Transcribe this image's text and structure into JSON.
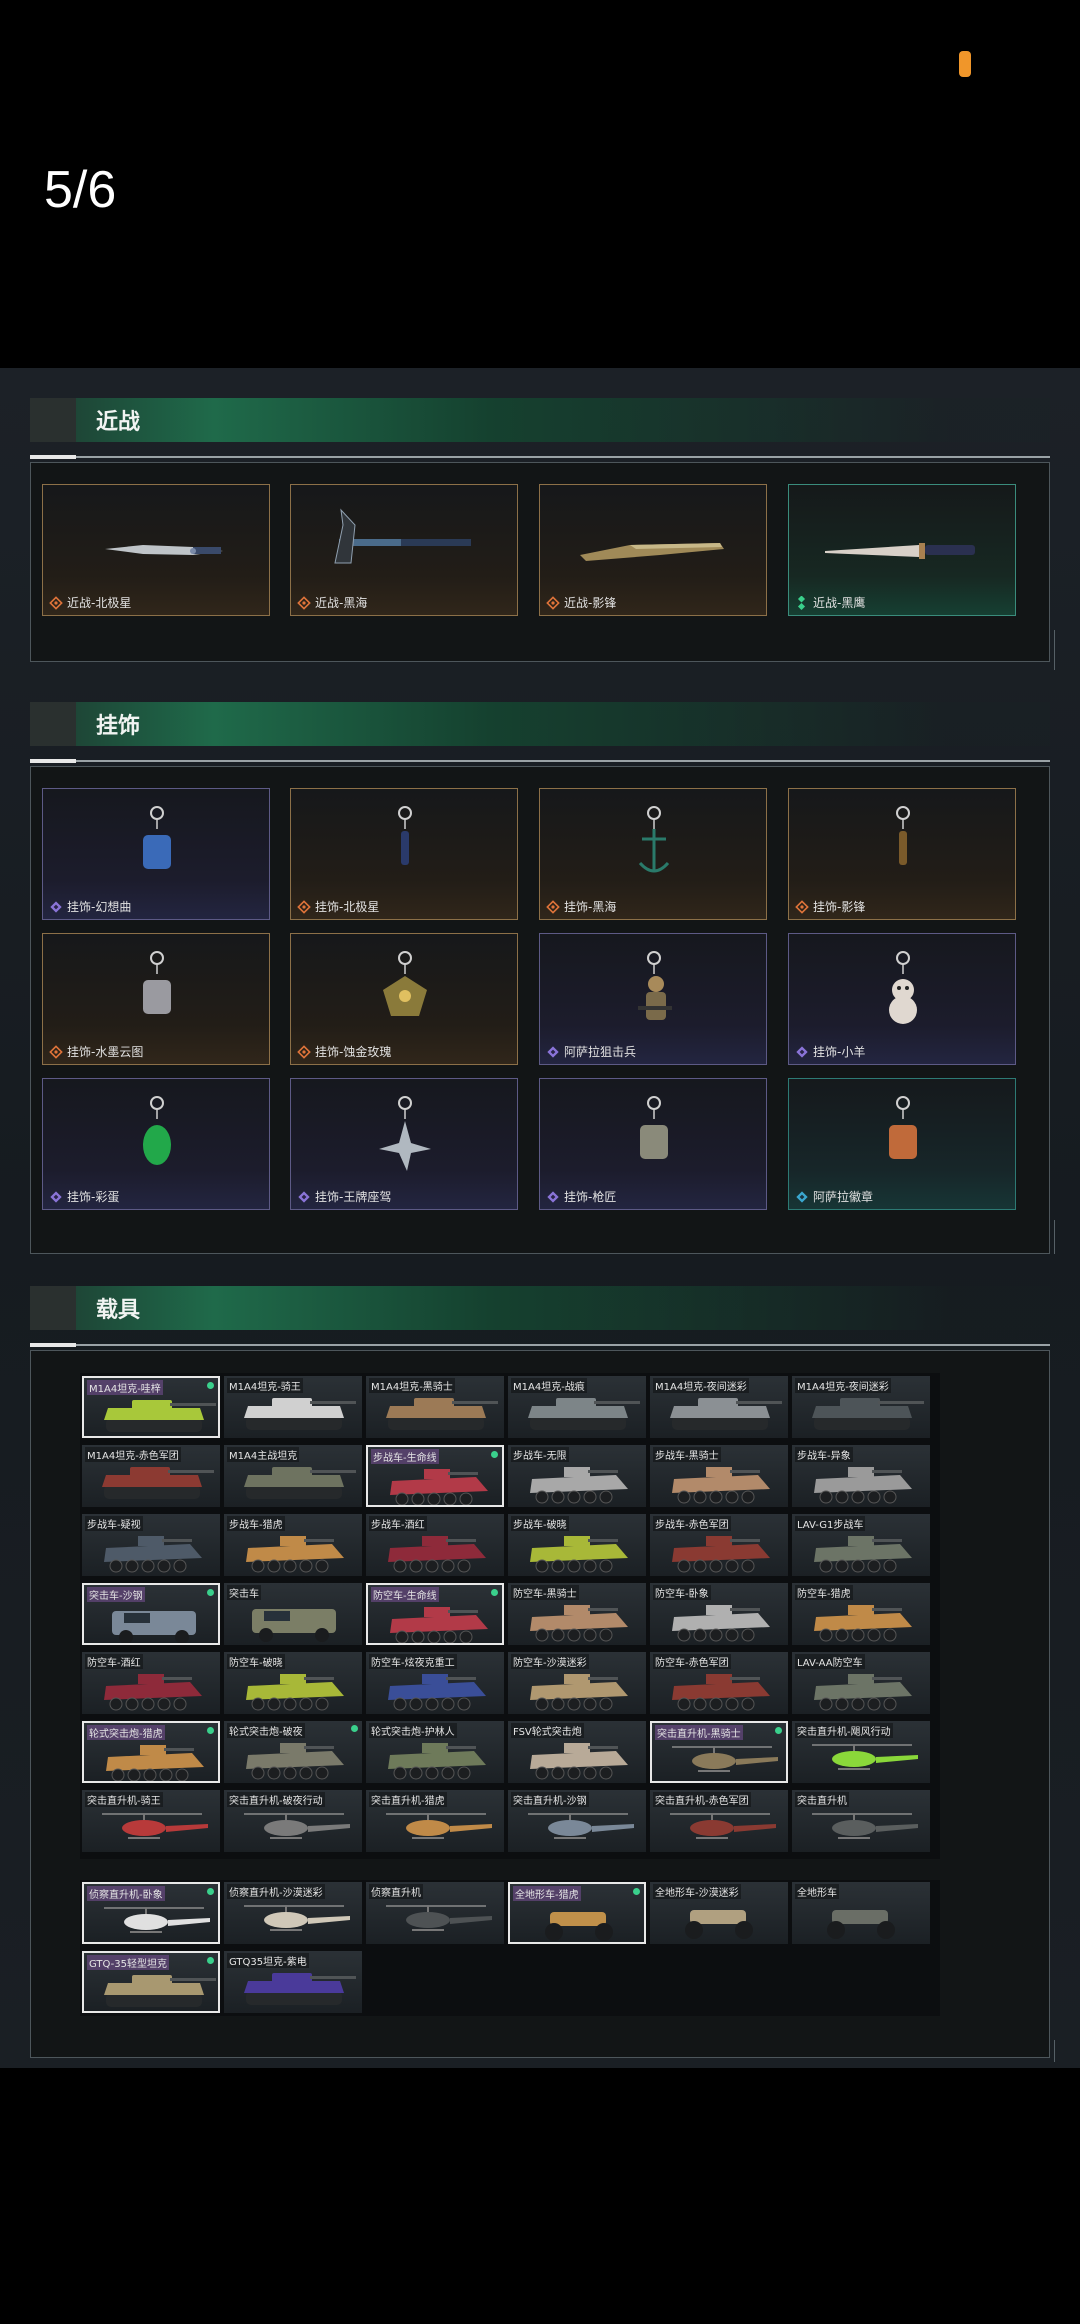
{
  "page_counter": "5/6",
  "sections": {
    "melee": {
      "title": "近战",
      "items": [
        {
          "label": "近战-北极星",
          "rarity": "gold",
          "icon": "orange-diamond-icon"
        },
        {
          "label": "近战-黑海",
          "rarity": "gold",
          "icon": "orange-diamond-icon"
        },
        {
          "label": "近战-影锋",
          "rarity": "gold",
          "icon": "orange-diamond-icon"
        },
        {
          "label": "近战-黑鹰",
          "rarity": "teal",
          "icon": "green-diamond-icon"
        }
      ]
    },
    "charms": {
      "title": "挂饰",
      "items": [
        {
          "label": "挂饰-幻想曲",
          "rarity": "purple"
        },
        {
          "label": "挂饰-北极星",
          "rarity": "gold"
        },
        {
          "label": "挂饰-黑海",
          "rarity": "gold"
        },
        {
          "label": "挂饰-影锋",
          "rarity": "gold"
        },
        {
          "label": "挂饰-水墨云图",
          "rarity": "gold"
        },
        {
          "label": "挂饰-蚀金玫瑰",
          "rarity": "gold"
        },
        {
          "label": "阿萨拉狙击兵",
          "rarity": "purple"
        },
        {
          "label": "挂饰-小羊",
          "rarity": "purple"
        },
        {
          "label": "挂饰-彩蛋",
          "rarity": "purple"
        },
        {
          "label": "挂饰-王牌座驾",
          "rarity": "purple"
        },
        {
          "label": "挂饰-枪匠",
          "rarity": "purple"
        },
        {
          "label": "阿萨拉徽章",
          "rarity": "tealb"
        }
      ]
    },
    "vehicles": {
      "title": "载具",
      "rows": [
        [
          {
            "label": "M1A4坦克-哇梓",
            "sel": true,
            "dot": true,
            "color": "#a8c83a",
            "type": "tank"
          },
          {
            "label": "M1A4坦克-骑王",
            "color": "#d0d0d0",
            "type": "tank"
          },
          {
            "label": "M1A4坦克-黑骑士",
            "color": "#9c7a56",
            "type": "tank"
          },
          {
            "label": "M1A4坦克-战痕",
            "color": "#7d8588",
            "type": "tank"
          },
          {
            "label": "M1A4坦克-夜间迷彩",
            "color": "#8b9094",
            "type": "tank"
          },
          {
            "label": "M1A4坦克-夜间迷彩",
            "color": "#4d5458",
            "type": "tank"
          }
        ],
        [
          {
            "label": "M1A4坦克-赤色军团",
            "color": "#8c3a32",
            "type": "tank"
          },
          {
            "label": "M1A4主战坦克",
            "color": "#6e7360",
            "type": "tank"
          },
          {
            "label": "步战车-生命线",
            "sel": true,
            "dot": true,
            "color": "#b23a48",
            "type": "ifv"
          },
          {
            "label": "步战车-无限",
            "color": "#a8a8a8",
            "type": "ifv"
          },
          {
            "label": "步战车-黑骑士",
            "color": "#b28a6a",
            "type": "ifv"
          },
          {
            "label": "步战车-异象",
            "color": "#9a9a9a",
            "type": "ifv"
          }
        ],
        [
          {
            "label": "步战车-疑视",
            "color": "#4e5a68",
            "type": "ifv"
          },
          {
            "label": "步战车-猎虎",
            "color": "#c08a48",
            "type": "ifv"
          },
          {
            "label": "步战车-酒红",
            "color": "#8e2a3a",
            "type": "ifv"
          },
          {
            "label": "步战车-破晓",
            "color": "#a8b838",
            "type": "ifv"
          },
          {
            "label": "步战车-赤色军团",
            "color": "#8a3a32",
            "type": "ifv"
          },
          {
            "label": "LAV-G1步战车",
            "color": "#6c7466",
            "type": "ifv"
          }
        ],
        [
          {
            "label": "突击车-沙钢",
            "sel": true,
            "dot": true,
            "color": "#7a8898",
            "type": "suv"
          },
          {
            "label": "突击车",
            "color": "#7b7e66",
            "type": "suv"
          },
          {
            "label": "防空车-生命线",
            "sel": true,
            "dot": true,
            "color": "#b23a48",
            "type": "ifv"
          },
          {
            "label": "防空车-黑骑士",
            "color": "#b28a6a",
            "type": "ifv"
          },
          {
            "label": "防空车-卧象",
            "color": "#b0b0b0",
            "type": "ifv"
          },
          {
            "label": "防空车-猎虎",
            "color": "#c08a48",
            "type": "ifv"
          }
        ],
        [
          {
            "label": "防空车-酒红",
            "color": "#8e2a3a",
            "type": "ifv"
          },
          {
            "label": "防空车-破晓",
            "color": "#a8b838",
            "type": "ifv"
          },
          {
            "label": "防空车-炫夜克重工",
            "color": "#3a4e98",
            "type": "ifv"
          },
          {
            "label": "防空车-沙漠迷彩",
            "color": "#b09870",
            "type": "ifv"
          },
          {
            "label": "防空车-赤色军团",
            "color": "#8a3a32",
            "type": "ifv"
          },
          {
            "label": "LAV-AA防空车",
            "color": "#6c7466",
            "type": "ifv"
          }
        ],
        [
          {
            "label": "轮式突击炮-猎虎",
            "sel": true,
            "dot": true,
            "color": "#c08a48",
            "type": "ifv"
          },
          {
            "label": "轮式突击炮-破夜",
            "dot": true,
            "color": "#7a7a6a",
            "type": "ifv"
          },
          {
            "label": "轮式突击炮-护林人",
            "color": "#6e7a5a",
            "type": "ifv"
          },
          {
            "label": "FSV轮式突击炮",
            "color": "#b8aa98",
            "type": "ifv"
          },
          {
            "label": "突击直升机-黑骑士",
            "sel": true,
            "dot": true,
            "color": "#8a7a5a",
            "type": "heli"
          },
          {
            "label": "突击直升机-飓风行动",
            "color": "#8ad83a",
            "type": "heli"
          }
        ],
        [
          {
            "label": "突击直升机-骑王",
            "color": "#b83a3a",
            "type": "heli"
          },
          {
            "label": "突击直升机-破夜行动",
            "color": "#7a7a7a",
            "type": "heli"
          },
          {
            "label": "突击直升机-猎虎",
            "color": "#c08a48",
            "type": "heli"
          },
          {
            "label": "突击直升机-沙钢",
            "color": "#7a8898",
            "type": "heli"
          },
          {
            "label": "突击直升机-赤色军团",
            "color": "#8a3a32",
            "type": "heli"
          },
          {
            "label": "突击直升机",
            "color": "#5a5e5e",
            "type": "heli"
          }
        ]
      ],
      "rows2": [
        [
          {
            "label": "侦察直升机-卧象",
            "sel": true,
            "dot": true,
            "color": "#e0e0e0",
            "type": "heli"
          },
          {
            "label": "侦察直升机-沙漠迷彩",
            "color": "#d0c8b8",
            "type": "heli"
          },
          {
            "label": "侦察直升机",
            "color": "#4e5254",
            "type": "heli"
          },
          {
            "label": "全地形车-猎虎",
            "sel": true,
            "dot": true,
            "color": "#c0904a",
            "type": "atv"
          },
          {
            "label": "全地形车-沙漠迷彩",
            "color": "#b0a080",
            "type": "atv"
          },
          {
            "label": "全地形车",
            "color": "#6a6e66",
            "type": "atv"
          }
        ],
        [
          {
            "label": "GTQ-35轻型坦克",
            "sel": true,
            "dot": true,
            "color": "#a89870",
            "type": "tank"
          },
          {
            "label": "GTQ35坦克-紫电",
            "color": "#4a3a9a",
            "type": "tank"
          }
        ]
      ]
    }
  }
}
